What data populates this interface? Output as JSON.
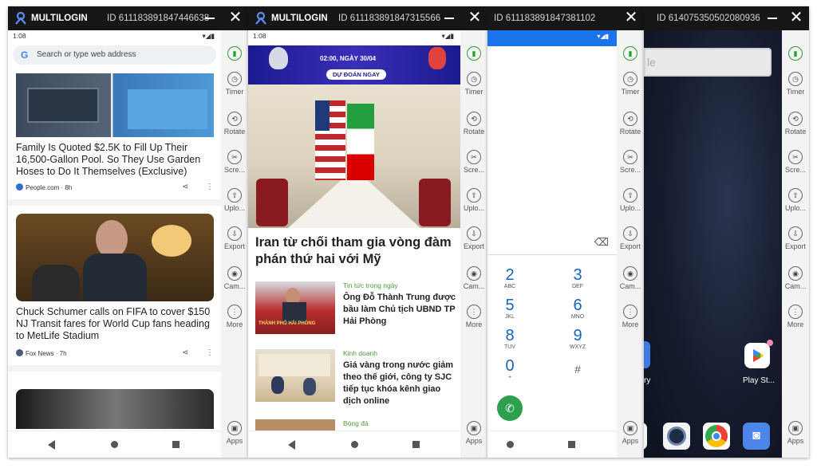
{
  "windows": [
    {
      "id_label": "ID 611183891847446638",
      "brand": "MULTILOGIN"
    },
    {
      "id_label": "ID 611183891847315566",
      "brand": "MULTILOGIN"
    },
    {
      "id_label": "ID 611183891847381102"
    },
    {
      "id_label": "ID 614075350502080936"
    }
  ],
  "sidebar": {
    "items": [
      "Timer",
      "Rotate",
      "Scre...",
      "Uplo...",
      "Export",
      "Cam...",
      "More"
    ],
    "apps": "Apps"
  },
  "phone1": {
    "time": "1:08",
    "search_placeholder": "Search or type web address",
    "articles": [
      {
        "headline": "Family Is Quoted $2.5K to Fill Up Their 16,500-Gallon Pool. So They Use Garden Hoses to Do It Themselves (Exclusive)",
        "source": "People.com · 8h"
      },
      {
        "headline": "Chuck Schumer calls on FIFA to cover $150 NJ Transit fares for World Cup fans heading to MetLife Stadium",
        "source": "Fox News · 7h"
      }
    ]
  },
  "phone2": {
    "time": "1:08",
    "banner_date": "02:00, NGÀY 30/04",
    "banner_cta": "DỰ ĐOÁN NGAY",
    "main_headline": "Iran từ chối tham gia vòng đàm phán thứ hai với Mỹ",
    "items": [
      {
        "category": "Tin tức trong ngày",
        "title": "Ông Đỗ Thành Trung được bầu làm Chủ tịch UBND TP Hải Phòng",
        "thumb_text": "THÀNH PHỐ HẢI PHÒNG"
      },
      {
        "category": "Kinh doanh",
        "title": "Giá vàng trong nước giảm theo thế giới, công ty SJC tiếp tục khóa kênh giao dịch online"
      },
      {
        "category": "Bóng đá"
      }
    ]
  },
  "phone3": {
    "keys": [
      {
        "n": "2",
        "l": "ABC"
      },
      {
        "n": "3",
        "l": "DEF"
      },
      {
        "n": "5",
        "l": "JKL"
      },
      {
        "n": "6",
        "l": "MNO"
      },
      {
        "n": "8",
        "l": "TUV"
      },
      {
        "n": "9",
        "l": "WXYZ"
      },
      {
        "n": "0",
        "l": "+"
      },
      {
        "n": "#",
        "l": ""
      }
    ]
  },
  "phone4": {
    "search_fragment": "le",
    "app_label_left": "ry",
    "app_label_right": "Play St..."
  }
}
